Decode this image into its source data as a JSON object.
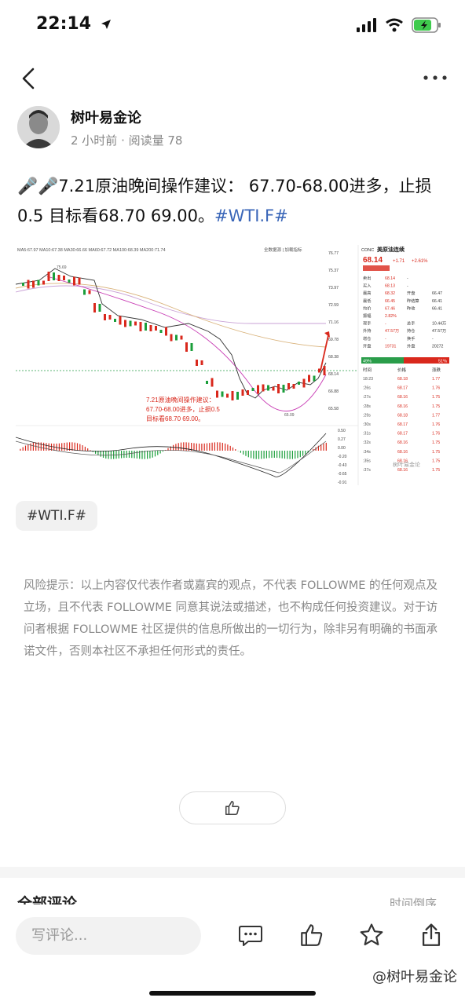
{
  "status_bar": {
    "time": "22:14"
  },
  "author": {
    "name": "树叶易金论",
    "meta": "2 小时前 · 阅读量 78"
  },
  "post": {
    "text": "🎤🎤7.21原油晚间操作建议： 67.70-68.00进多，止损0.5 目标看68.70 69.00。",
    "hashtag": "#WTI.F#"
  },
  "chart_image": {
    "ticker_title": "美原油连续",
    "ticker_code": "CONC",
    "price": "68.14",
    "change": "+1.71",
    "change_pct": "+2.61%",
    "ma_legend": "MA5:67.97  MA10:67.38  MA30:66.66  MA60:67.72  MA100:68.39  MA200:71.74",
    "top_buttons": "全数据源 | 加载指标",
    "peak_label": "75.69",
    "low_label": "65.09",
    "annotation_line1": "7.21原油晚间操作建议：",
    "annotation_line2": "67.70-68.00进多，止损0.5",
    "annotation_line3": "目标看68.70   69.00。",
    "y_ticks": [
      "76.77",
      "75.37",
      "73.97",
      "72.59",
      "71.16",
      "69.78",
      "68.38",
      "68.14",
      "66.88",
      "65.58"
    ],
    "macd_ticks": [
      "0.50",
      "0.27",
      "0.00",
      "-0.20",
      "-0.43",
      "-0.65",
      "-0.91"
    ],
    "quote_rows": [
      [
        "卖出",
        "68.14",
        "-",
        ""
      ],
      [
        "买入",
        "68.13",
        "-",
        ""
      ],
      [
        "最高",
        "68.32",
        "开盘",
        "66.47"
      ],
      [
        "最低",
        "66.45",
        "昨结算",
        "66.41"
      ],
      [
        "均价",
        "67.46",
        "昨收",
        "66.41"
      ],
      [
        "振幅",
        "2.82%",
        "",
        ""
      ],
      [
        "现手",
        "-",
        "总手",
        "10.44万"
      ],
      [
        "外持",
        "47.57万",
        "持仓",
        "47.57万"
      ],
      [
        "增仓",
        "-",
        "换手",
        "-"
      ],
      [
        "开盘",
        "19731",
        "外盘",
        "20272"
      ]
    ],
    "ratio_left": "49%",
    "ratio_right": "51%",
    "trades_header": [
      "时间",
      "价格",
      "涨跌"
    ],
    "trades": [
      [
        "18:23",
        "68.18",
        "1.77"
      ],
      [
        ":26s",
        "68.17",
        "1.76"
      ],
      [
        ":27s",
        "68.16",
        "1.75"
      ],
      [
        ":28s",
        "68.16",
        "1.75"
      ],
      [
        ":29s",
        "68.18",
        "1.77"
      ],
      [
        ":30s",
        "68.17",
        "1.76"
      ],
      [
        ":31s",
        "68.17",
        "1.76"
      ],
      [
        ":32s",
        "68.16",
        "1.75"
      ],
      [
        ":34s",
        "68.16",
        "1.75"
      ],
      [
        ":35s",
        "68.16",
        "1.75"
      ],
      [
        ":37s",
        "68.16",
        "1.75"
      ]
    ],
    "inner_watermark": "树叶易金论"
  },
  "tag_chip": "#WTI.F#",
  "risk_notice": "风险提示：以上内容仅代表作者或嘉宾的观点，不代表 FOLLOWME 的任何观点及立场，且不代表 FOLLOWME 同意其说法或描述，也不构成任何投资建议。对于访问者根据 FOLLOWME 社区提供的信息所做出的一切行为，除非另有明确的书面承诺文件，否则本社区不承担任何形式的责任。",
  "comments": {
    "title": "全部评论",
    "sort": "时间倒序"
  },
  "bottom_bar": {
    "comment_placeholder": "写评论...",
    "watermark": "@树叶易金论"
  },
  "icons": [
    "back-arrow-icon",
    "more-dots-icon",
    "thumbs-up-icon",
    "comment-icon",
    "star-icon",
    "share-icon",
    "signal-icon",
    "wifi-icon",
    "battery-icon",
    "location-arrow-icon"
  ],
  "colors": {
    "hashtag": "#3a66b8",
    "up_red": "#d9281c",
    "down_green": "#1a9e3a"
  }
}
